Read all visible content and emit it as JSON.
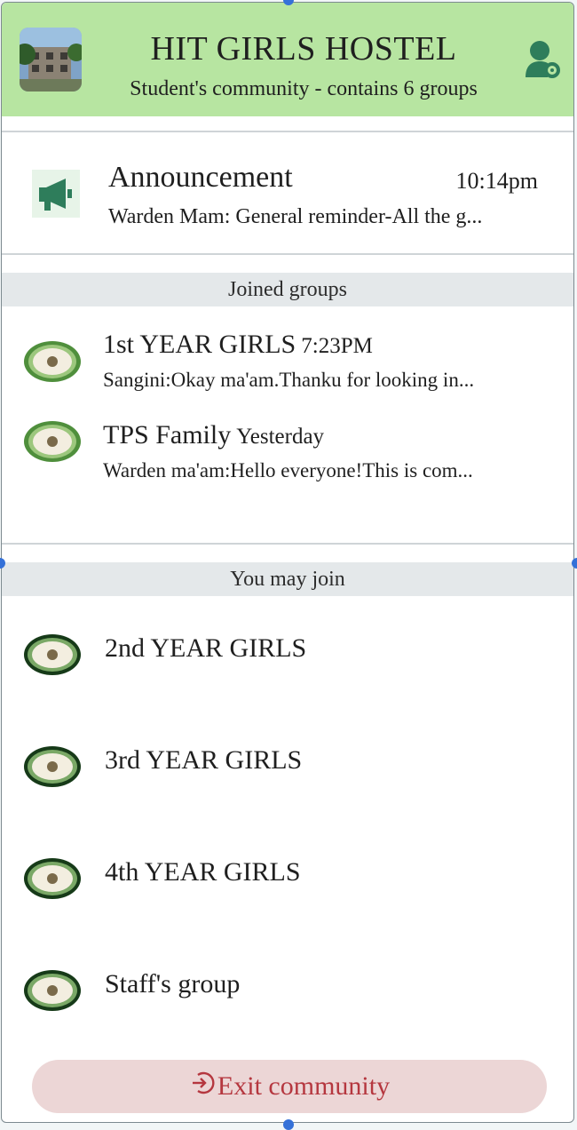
{
  "header": {
    "title": "HIT GIRLS HOSTEL",
    "subtitle": "Student's community - contains 6 groups",
    "photo_icon": "community-photo",
    "member_icon": "person-gear-icon"
  },
  "announcement": {
    "title": "Announcement",
    "time": "10:14pm",
    "preview": "Warden Mam: General reminder-All the g...",
    "icon": "megaphone-icon"
  },
  "joined": {
    "label": "Joined groups",
    "items": [
      {
        "name": "1st YEAR GIRLS",
        "time": "7:23PM",
        "preview": "Sangini:Okay ma'am.Thanku for looking in..."
      },
      {
        "name": "TPS Family",
        "time": "Yesterday",
        "preview": "Warden ma'am:Hello everyone!This is com..."
      }
    ]
  },
  "may_join": {
    "label": "You may join",
    "items": [
      {
        "name": "2nd YEAR GIRLS"
      },
      {
        "name": "3rd YEAR GIRLS"
      },
      {
        "name": "4th YEAR GIRLS"
      },
      {
        "name": "Staff's group"
      }
    ]
  },
  "exit": {
    "label": "Exit community",
    "icon": "exit-icon"
  },
  "colors": {
    "header_bg": "#b7e5a1",
    "accent_green": "#2e7d5b",
    "exit_bg": "#ecd6d6",
    "exit_text": "#b5373f"
  }
}
